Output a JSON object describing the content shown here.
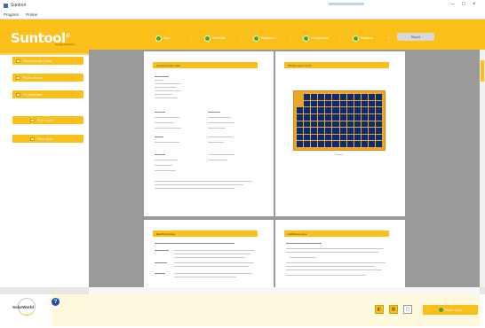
{
  "window": {
    "title": "Suntool",
    "controls": [
      "–",
      "□",
      "×"
    ]
  },
  "menu": [
    "Program",
    "Printer"
  ],
  "app": {
    "logo": "Suntool",
    "logo_mark": "©",
    "logo_sub": "Design software"
  },
  "steps": [
    {
      "label": "Start"
    },
    {
      "label": "Site/Roof"
    },
    {
      "label": "Equipment"
    },
    {
      "label": "Arrangement"
    },
    {
      "label": "Electrical"
    }
  ],
  "active_step": "Report",
  "sidebar": {
    "items": [
      {
        "label": "General project data"
      },
      {
        "label": "Roof surfaces"
      },
      {
        "label": "PV-Generator"
      },
      {
        "label": "PDF export"
      },
      {
        "label": "Print report"
      }
    ]
  },
  "pages": [
    {
      "header": "General project data"
    },
    {
      "header": "Module layout (roof)"
    },
    {
      "header": "Electrical layout"
    },
    {
      "header": "Additional notes"
    }
  ],
  "footer": {
    "logo": "SolarWorld",
    "help": "?",
    "tools": [
      "◧",
      "▦",
      "▢"
    ],
    "finish_label": "Finish report"
  },
  "colors": {
    "accent": "#fbbf1a",
    "step_done": "#3cae2f",
    "panel_cell": "#0d2a73"
  }
}
